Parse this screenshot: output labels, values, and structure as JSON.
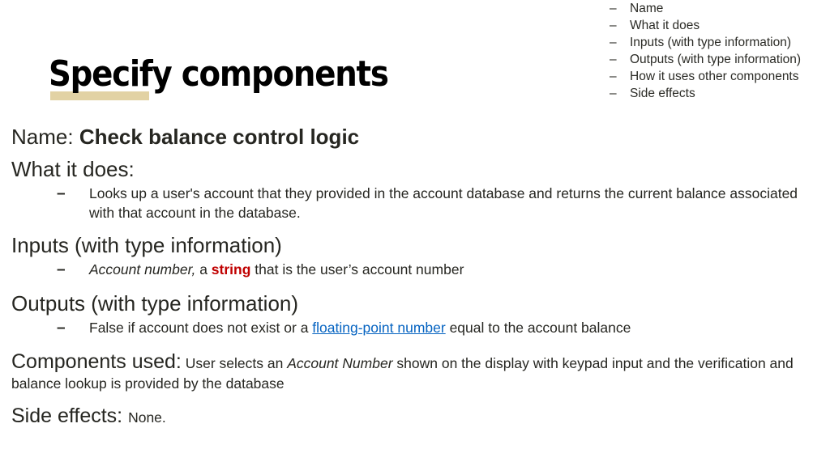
{
  "slide": {
    "title": "Specify components",
    "accent_bar_color": "#e2d2a4",
    "text_color": "#262621",
    "link_color": "#0563C1",
    "keyword_color": "#C00000",
    "background_color": "#ffffff"
  },
  "reference_list": {
    "dash": "–",
    "items": [
      "Name",
      "What it does",
      "Inputs (with type information)",
      "Outputs (with type information)",
      "How it uses other components",
      "Side effects"
    ]
  },
  "body": {
    "bullet_dash": "–",
    "name": {
      "label": "Name:",
      "value": "Check balance control logic"
    },
    "what_it_does": {
      "heading": "What it does:",
      "bullet": "Looks up a user's account that they provided in the account database and returns the current balance associated with that account in the database."
    },
    "inputs": {
      "heading": "Inputs (with type information)",
      "bullet_italic": "Account number,",
      "bullet_mid": " a ",
      "bullet_keyword": "string",
      "bullet_tail": " that is the user’s account number"
    },
    "outputs": {
      "heading": "Outputs (with type information)",
      "bullet_pre": "False if account does not exist or a ",
      "bullet_link": "floating-point number",
      "bullet_post": " equal to the account balance"
    },
    "components_used": {
      "heading": "Components used:",
      "text_pre": " User selects an ",
      "text_italic": "Account Number",
      "text_post": " shown on the display with keypad input and the verification and balance lookup is provided by the database"
    },
    "side_effects": {
      "heading": "Side effects:",
      "value": "None."
    }
  }
}
